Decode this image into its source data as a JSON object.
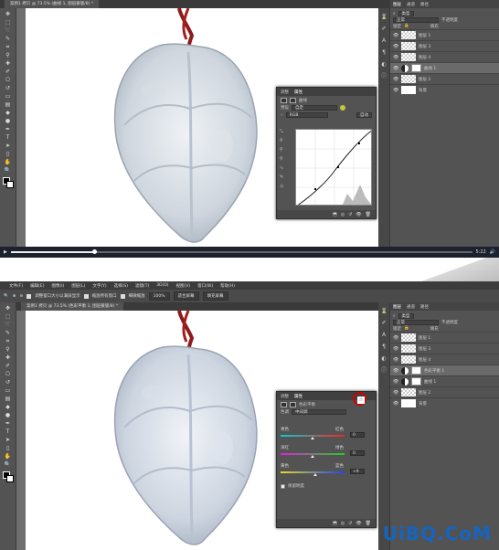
{
  "top": {
    "doc_tab": "案例1 拷贝 @ 73.5% (曲线 1, 图层蒙版/8) *",
    "video": {
      "time": "5:22",
      "progress": 0.18
    },
    "layers_tabs": [
      "图层",
      "通道",
      "路径"
    ],
    "filter_label": "类型",
    "blend_mode": "正常",
    "opacity_label": "不透明度",
    "lock_label": "锁定",
    "fill_label": "填充",
    "layers": [
      "图层 1",
      "图层 3",
      "图层 4",
      "曲线 1",
      "图层 2",
      "背景"
    ],
    "active_layer": "曲线 1",
    "props": {
      "tabs": [
        "调整",
        "属性"
      ],
      "title": "曲线",
      "preset_label": "预设",
      "preset_value": "自定",
      "channel_value": "RGB",
      "auto_button": "自动"
    }
  },
  "bottom": {
    "menu": [
      "文件(F)",
      "编辑(E)",
      "图像(I)",
      "图层(L)",
      "文字(Y)",
      "选择(S)",
      "滤镜(T)",
      "3D(D)",
      "视图(V)",
      "窗口(W)",
      "帮助(H)"
    ],
    "options": {
      "resize_windows": "调整窗口大小以满屏显示",
      "zoom_all": "缩放所有窗口",
      "scrubby_zoom": "细微缩放",
      "zoom_value": "100%",
      "fit_screen": "适合屏幕",
      "fill_screen": "填充屏幕"
    },
    "doc_tab": "案例1 拷贝 @ 73.5% (色彩平衡 1, 图层蒙版/8) *",
    "layers_tabs": [
      "图层",
      "通道",
      "路径"
    ],
    "filter_label": "类型",
    "blend_mode": "正常",
    "opacity_label": "不透明度",
    "lock_label": "锁定",
    "fill_label": "填充",
    "layers": [
      "图层 1",
      "图层 3",
      "图层 4",
      "色彩平衡 1",
      "曲线 1",
      "图层 2",
      "背景"
    ],
    "active_layer": "色彩平衡 1",
    "props": {
      "tabs": [
        "调整",
        "属性"
      ],
      "title": "色彩平衡",
      "tone_label": "色调",
      "tone_value": "中间调",
      "sliders": [
        {
          "left": "青色",
          "right": "红色",
          "value": "0"
        },
        {
          "left": "洋红",
          "right": "绿色",
          "value": "0"
        },
        {
          "left": "黄色",
          "right": "蓝色",
          "value": "+9"
        }
      ],
      "preserve_luminosity": "保留明度"
    }
  },
  "watermark": "UiBQ.CoM"
}
